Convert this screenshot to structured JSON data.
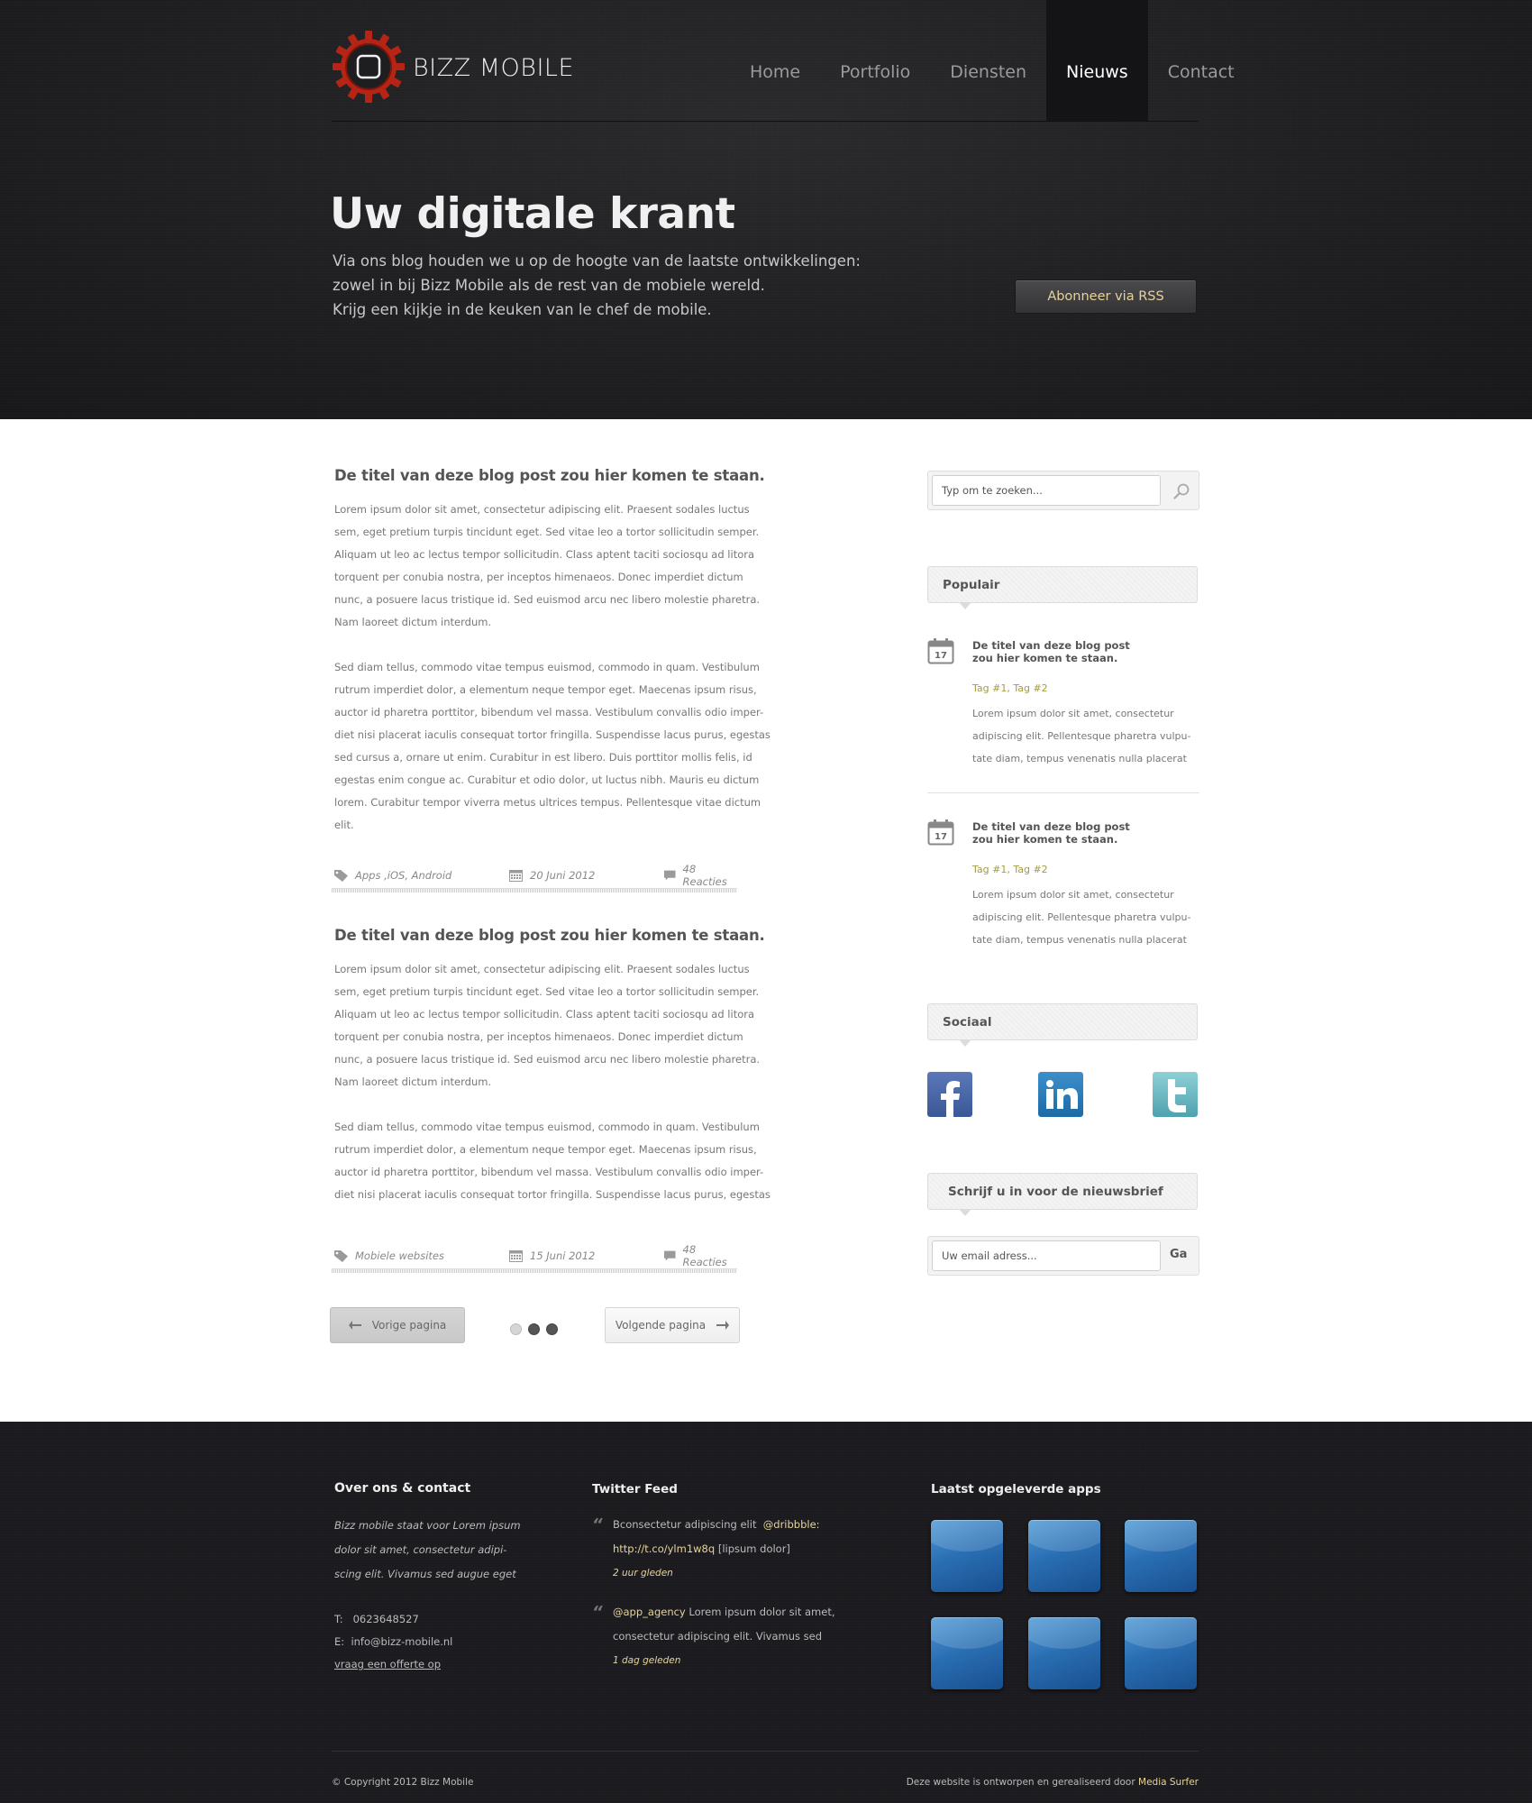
{
  "brand": {
    "name": "BIZZ MOBILE"
  },
  "nav": {
    "items": [
      {
        "label": "Home"
      },
      {
        "label": "Portfolio"
      },
      {
        "label": "Diensten"
      },
      {
        "label": "Nieuws"
      },
      {
        "label": "Contact"
      }
    ],
    "active": "Nieuws"
  },
  "hero": {
    "title": "Uw digitale krant",
    "lines": [
      "Via ons blog houden we u op de hoogte van de laatste ontwikkelingen:",
      "zowel in bij Bizz Mobile als de rest van de mobiele wereld.",
      "Krijg een kijkje in de keuken van le chef de mobile."
    ],
    "rss_label": "Abonneer via RSS"
  },
  "posts": [
    {
      "title": "De titel van deze blog post  zou hier komen te staan.",
      "p1": [
        "Lorem ipsum dolor sit amet, consectetur adipiscing elit. Praesent sodales luctus",
        "sem, eget pretium turpis tincidunt eget. Sed vitae leo a tortor sollicitudin semper.",
        "Aliquam ut leo ac lectus tempor sollicitudin. Class aptent taciti sociosqu ad litora",
        "torquent per conubia nostra, per inceptos himenaeos. Donec imperdiet dictum",
        "nunc, a posuere lacus tristique id. Sed euismod arcu nec libero molestie pharetra.",
        "Nam laoreet dictum interdum."
      ],
      "p2": [
        "Sed diam tellus, commodo vitae tempus euismod, commodo in quam. Vestibulum",
        "rutrum imperdiet dolor, a elementum neque tempor eget. Maecenas ipsum risus,",
        "auctor id pharetra porttitor, bibendum vel massa. Vestibulum convallis odio imper-",
        "diet nisi placerat iaculis consequat tortor fringilla. Suspendisse lacus purus, egestas",
        "sed cursus a, ornare ut enim. Curabitur in est libero. Duis porttitor mollis felis, id",
        "egestas enim congue ac. Curabitur et odio dolor, ut luctus nibh. Mauris eu dictum",
        "lorem. Curabitur tempor viverra metus ultrices tempus. Pellentesque vitae dictum",
        "elit."
      ],
      "tags": "Apps ,iOS, Android",
      "date": "20 Juni 2012",
      "comments": "48 Reacties"
    },
    {
      "title": "De titel van deze blog post  zou hier komen te staan.",
      "p1": [
        "Lorem ipsum dolor sit amet, consectetur adipiscing elit. Praesent sodales luctus",
        "sem, eget pretium turpis tincidunt eget. Sed vitae leo a tortor sollicitudin semper.",
        "Aliquam ut leo ac lectus tempor sollicitudin. Class aptent taciti sociosqu ad litora",
        "torquent per conubia nostra, per inceptos himenaeos. Donec imperdiet dictum",
        "nunc, a posuere lacus tristique id. Sed euismod arcu nec libero molestie pharetra.",
        "Nam laoreet dictum interdum."
      ],
      "p2": [
        "Sed diam tellus, commodo vitae tempus euismod, commodo in quam. Vestibulum",
        "rutrum imperdiet dolor, a elementum neque tempor eget. Maecenas ipsum risus,",
        "auctor id pharetra porttitor, bibendum vel massa. Vestibulum convallis odio imper-",
        "diet nisi placerat iaculis consequat tortor fringilla. Suspendisse lacus purus, egestas"
      ],
      "tags": "Mobiele websites",
      "date": "15 Juni 2012",
      "comments": "48 Reacties"
    }
  ],
  "pagination": {
    "prev_label": "Vorige pagina",
    "next_label": "Volgende pagina",
    "pages": 3,
    "current": 1
  },
  "sidebar": {
    "search_placeholder": "Typ om te zoeken...",
    "popular": {
      "heading": "Populair",
      "items": [
        {
          "title_line1": "De titel van deze blog post",
          "title_line2": "zou hier komen te staan.",
          "day": "17",
          "tags": "Tag #1, Tag #2",
          "text": [
            "Lorem ipsum dolor sit amet, consectetur",
            "adipiscing elit. Pellentesque pharetra vulpu-",
            "tate diam, tempus venenatis nulla placerat"
          ]
        },
        {
          "title_line1": "De titel van deze blog post",
          "title_line2": "zou hier komen te staan.",
          "day": "17",
          "tags": "Tag #1, Tag #2",
          "text": [
            "Lorem ipsum dolor sit amet, consectetur",
            "adipiscing elit. Pellentesque pharetra vulpu-",
            "tate diam, tempus venenatis nulla placerat"
          ]
        }
      ]
    },
    "social": {
      "heading": "Sociaal",
      "icons": [
        "facebook-icon",
        "linkedin-icon",
        "twitter-icon"
      ]
    },
    "newsletter": {
      "heading": "Schrijf u in voor de nieuwsbrief",
      "placeholder": "Uw email adress...",
      "go_label": "Ga"
    }
  },
  "footer": {
    "about": {
      "heading": "Over ons & contact",
      "lines": [
        "Bizz mobile staat voor Lorem ipsum",
        "dolor sit amet, consectetur adipi-",
        "scing elit. Vivamus sed augue eget"
      ],
      "phone_label": "T:",
      "phone": "0623648527",
      "email_label": "E:",
      "email": "info@bizz-mobile.nl",
      "quote_link": "vraag een offerte op"
    },
    "twitter": {
      "heading": "Twitter Feed",
      "tweet1": {
        "text1": "Bconsectetur adipiscing elit",
        "handle": "@dribbble:",
        "link": "http://t.co/ylm1w8q",
        "text2": "[lipsum dolor]",
        "time": "2 uur gleden"
      },
      "tweet2": {
        "handle": "@app_agency",
        "text1": "Lorem ipsum dolor sit amet,",
        "text2": "consectetur adipiscing elit. Vivamus sed",
        "time": "1 dag geleden"
      }
    },
    "apps": {
      "heading": "Laatst opgeleverde apps",
      "count": 6
    },
    "copyright": "© Copyright 2012 Bizz Mobile",
    "credit_text": "Deze website is ontworpen en gerealiseerd door",
    "credit_link": "Media Surfer"
  },
  "colors": {
    "accent_gold": "#e6d39a",
    "tag_olive": "#a39a42",
    "logo_red": "#c0281b"
  }
}
